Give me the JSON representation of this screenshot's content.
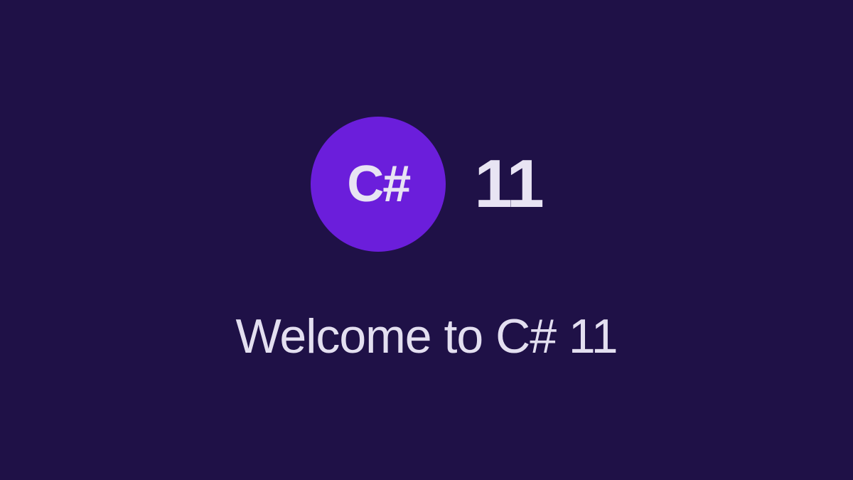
{
  "logo": {
    "badge_text": "C#",
    "version": "11"
  },
  "heading": {
    "text": "Welcome to C# 11"
  },
  "colors": {
    "background": "#1f1147",
    "accent": "#6b1edb",
    "text": "#e8e4f3"
  }
}
